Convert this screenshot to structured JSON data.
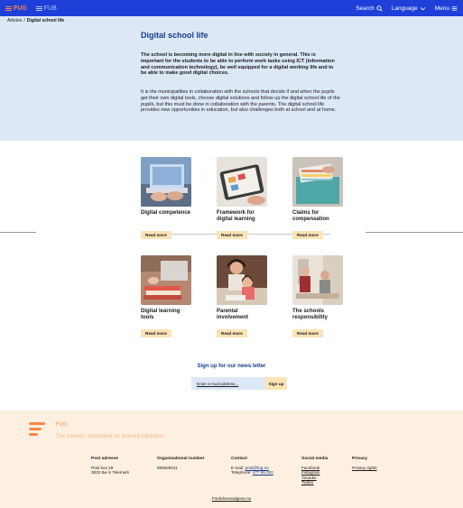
{
  "header": {
    "logo_main": "FUG",
    "logo_alt": "FUB",
    "search_label": "Search",
    "language_label": "Language",
    "menu_label": "Menu"
  },
  "breadcrumb": {
    "parent": "Articles",
    "separator": "/",
    "current": "Digital school life"
  },
  "hero": {
    "title": "Digital school life",
    "lead": "The school is becoming more digital in line with society in general. This is important for the students to be able to perform work tasks using ICT (information and communication technology), be well equipped for a digital working life and to be able to make good digital choices.",
    "body": "It is the municipalities in collaboration with the schools that decide if and when the pupils get their own digital tools, choose digital solutions and follow up the digital school life of the pupils, but this must be done in collaboration with the parents. The digital school life provides new opportunities in education, but also challenges both at school and at home."
  },
  "cards": [
    {
      "title": "Digital competence",
      "button": "Read more"
    },
    {
      "title": "Framework for digital learning",
      "button": "Read more"
    },
    {
      "title": "Claims for compensation",
      "button": "Read more"
    },
    {
      "title": "Digital learning tools",
      "button": "Read more"
    },
    {
      "title": "Parental involvement",
      "button": "Read more"
    },
    {
      "title": "The schools responsibility",
      "button": "Read more"
    }
  ],
  "newsletter": {
    "title": "Sign up for our news letter",
    "placeholder": "Enter e-mail address...",
    "button": "Sign up"
  },
  "footer": {
    "name": "FUG",
    "tagline": "The parents' committee for primary education",
    "columns": {
      "post": {
        "heading": "Post adresse",
        "line1": "Post box 29",
        "line2": "3833 Bø in Telemark"
      },
      "org": {
        "heading": "Organisational number",
        "line1": "989628011"
      },
      "contact": {
        "heading": "Contact",
        "email_label": "E-mail: ",
        "email": "post@fug.no",
        "phone_label": "Telephone: ",
        "phone": "477 99 200"
      },
      "social": {
        "heading": "Social media",
        "facebook": "Facebook",
        "instagram": "Instagram",
        "youtube": "Youtube",
        "twitter": "Twitter"
      },
      "privacy": {
        "heading": "Privacy",
        "link": "Privacy rights"
      }
    },
    "bottom_link": "Foreldreutvalgene.no"
  },
  "colors": {
    "topbar": "#1e3fd8",
    "accent": "#f7894a",
    "hero_bg": "#dde8f7",
    "title_blue": "#173c8c",
    "button_bg": "#fce4b5",
    "footer_bg": "#fdf0e0"
  },
  "icons": {
    "search": "search-icon",
    "language": "chevron-down-icon",
    "menu": "menu-icon"
  }
}
